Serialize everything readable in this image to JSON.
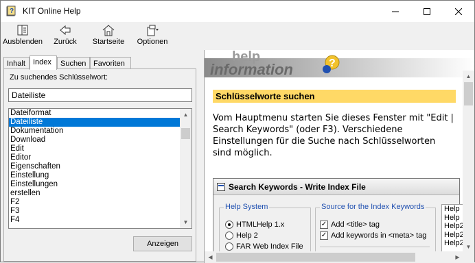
{
  "window": {
    "title": "KIT Online Help",
    "minimize": "–",
    "maximize": "☐",
    "close": "✕"
  },
  "toolbar": {
    "items": [
      {
        "label": "Ausblenden",
        "icon": "hide-pane-icon"
      },
      {
        "label": "Zurück",
        "icon": "back-arrow-icon"
      },
      {
        "label": "Startseite",
        "icon": "home-icon"
      },
      {
        "label": "Optionen",
        "icon": "options-icon"
      }
    ]
  },
  "tabs": [
    {
      "label": "Inhalt",
      "active": false
    },
    {
      "label": "Index",
      "active": true
    },
    {
      "label": "Suchen",
      "active": false
    },
    {
      "label": "Favoriten",
      "active": false
    }
  ],
  "index": {
    "keyword_label": "Zu suchendes Schlüsselwort:",
    "keyword_value": "Dateiliste",
    "items": [
      "Dateiformat",
      "Dateiliste",
      "Dokumentation",
      "Download",
      "Edit",
      "Editor",
      "Eigenschaften",
      "Einstellung",
      "Einstellungen",
      "erstellen",
      "F2",
      "F3",
      "F4"
    ],
    "selected_index": 1,
    "show_button": "Anzeigen"
  },
  "content": {
    "banner_text": "help information",
    "heading": "Schlüsselworte suchen",
    "paragraph": "Vom Hauptmenu starten Sie dieses Fenster mit \"Edit | Search Keywords\" (oder F3). Verschiedene Einstellungen für die Suche nach Schlüsselworten sind möglich.",
    "dialog": {
      "title": "Search Keywords - Write Index File",
      "help_system_label": "Help System",
      "help_system_options": [
        {
          "label": "HTMLHelp 1.x",
          "selected": true
        },
        {
          "label": "Help 2",
          "selected": false
        },
        {
          "label": "FAR Web Index File",
          "selected": false
        }
      ],
      "source_label": "Source for the Index Keywords",
      "source_options": [
        {
          "label": "Add <title> tag",
          "checked": true
        },
        {
          "label": "Add keywords in <meta> tag",
          "checked": true
        }
      ],
      "list_items": [
        "Help",
        "Help",
        "Help2",
        "Help2",
        "Help2"
      ]
    }
  },
  "colors": {
    "selection": "#0078d7",
    "heading_bg": "#ffd966",
    "group_label": "#2050b0"
  }
}
